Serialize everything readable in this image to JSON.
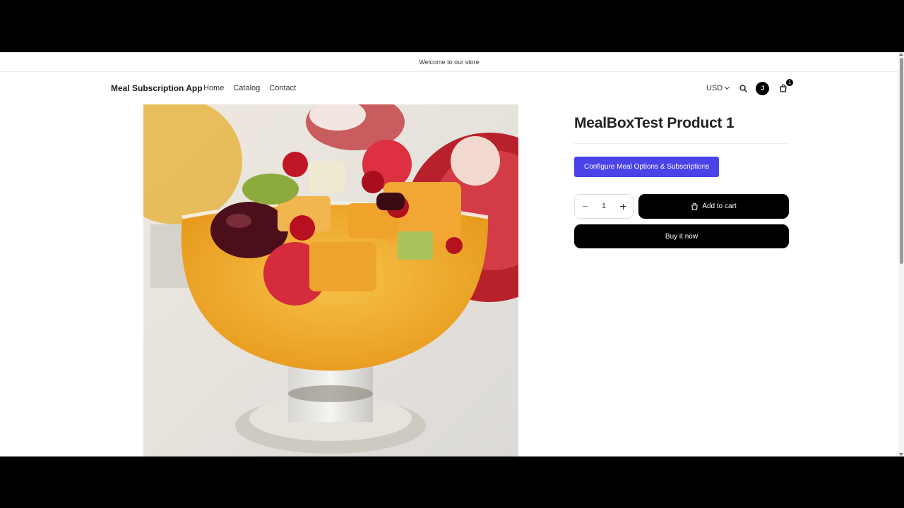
{
  "announcement": {
    "text": "Welcome to our store"
  },
  "header": {
    "brand": "Meal Subscription App",
    "nav": [
      {
        "label": "Home"
      },
      {
        "label": "Catalog"
      },
      {
        "label": "Contact"
      }
    ],
    "currency": "USD",
    "avatar_initial": "J",
    "cart_count": "1",
    "icons": {
      "search": "search-icon",
      "cart": "cart-icon",
      "currency": "chevron-down-icon"
    }
  },
  "product": {
    "title": "MealBoxTest Product 1",
    "image_alt": "fruit-salad-in-glass-dessert-cup",
    "config_button": "Configure Meal Options & Subscriptions",
    "quantity": "1",
    "add_to_cart": "Add to cart",
    "buy_now": "Buy it now"
  },
  "colors": {
    "accent": "#4b43e8",
    "primary_button": "#000000",
    "background": "#ffffff"
  }
}
